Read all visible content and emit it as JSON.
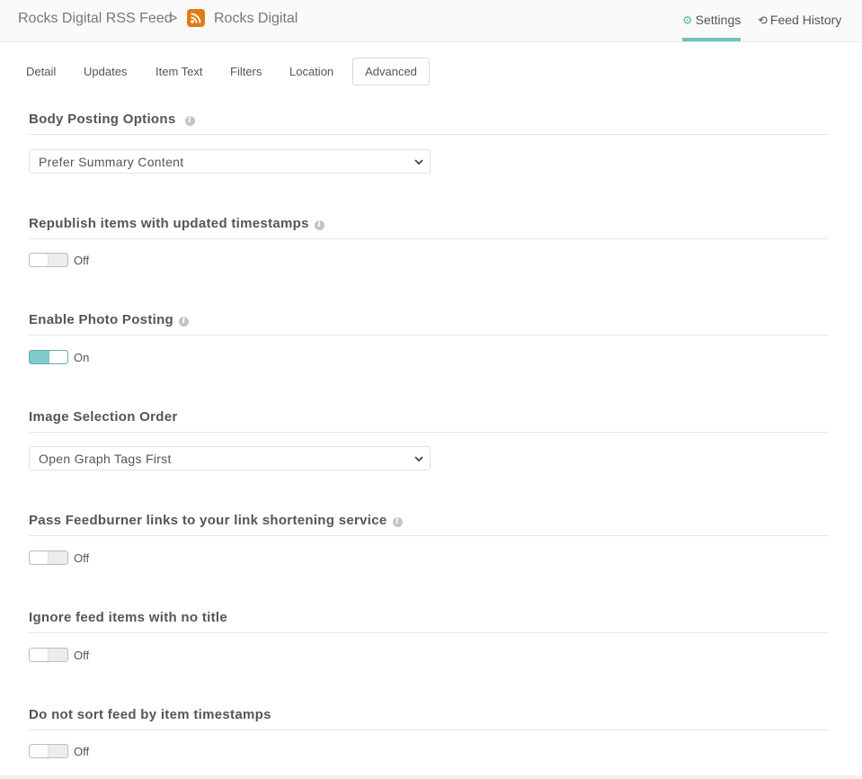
{
  "header": {
    "breadcrumb_root": "Rocks Digital RSS Feed",
    "breadcrumb_separator": ">",
    "breadcrumb_current": "Rocks Digital",
    "nav_settings": "Settings",
    "nav_history": "Feed History",
    "accent_color": "#6ec3c3",
    "rss_color": "#e07b16"
  },
  "tabs": [
    {
      "label": "Detail"
    },
    {
      "label": "Updates"
    },
    {
      "label": "Item Text"
    },
    {
      "label": "Filters"
    },
    {
      "label": "Location"
    },
    {
      "label": "Advanced",
      "active": true
    }
  ],
  "sections": {
    "body_posting": {
      "title": "Body Posting Options",
      "selected": "Prefer Summary Content"
    },
    "republish": {
      "title": "Republish items with updated timestamps",
      "state": "Off"
    },
    "photo_posting": {
      "title": "Enable Photo Posting",
      "state": "On"
    },
    "image_order": {
      "title": "Image Selection Order",
      "selected": "Open Graph Tags First"
    },
    "feedburner": {
      "title": "Pass Feedburner links to your link shortening service",
      "state": "Off"
    },
    "ignore_untitled": {
      "title": "Ignore feed items with no title",
      "state": "Off"
    },
    "no_sort": {
      "title": "Do not sort feed by item timestamps",
      "state": "Off"
    }
  }
}
